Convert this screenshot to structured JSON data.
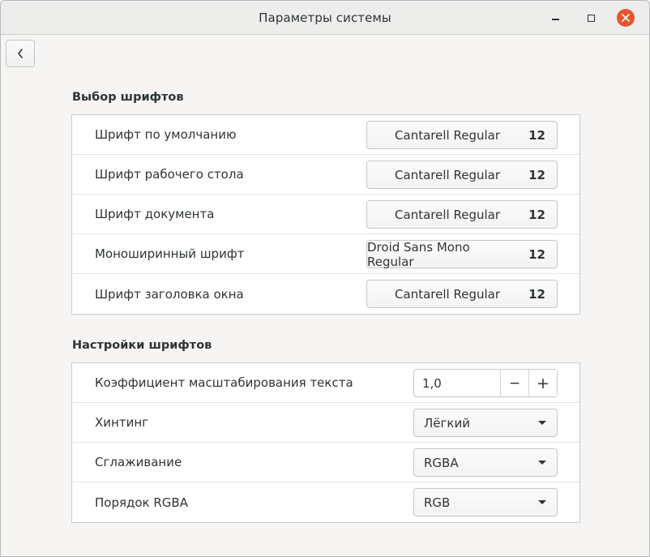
{
  "window": {
    "title": "Параметры системы"
  },
  "fonts_section": {
    "title": "Выбор шрифтов",
    "rows": [
      {
        "label": "Шрифт по умолчанию",
        "font": "Cantarell Regular",
        "size": "12"
      },
      {
        "label": "Шрифт рабочего стола",
        "font": "Cantarell Regular",
        "size": "12"
      },
      {
        "label": "Шрифт документа",
        "font": "Cantarell Regular",
        "size": "12"
      },
      {
        "label": "Моноширинный шрифт",
        "font": "Droid Sans Mono Regular",
        "size": "12"
      },
      {
        "label": "Шрифт заголовка окна",
        "font": "Cantarell Regular",
        "size": "12"
      }
    ]
  },
  "settings_section": {
    "title": "Настройки шрифтов",
    "scale": {
      "label": "Коэффициент масштабирования текста",
      "value": "1,0",
      "minus": "−",
      "plus": "+"
    },
    "hinting": {
      "label": "Хинтинг",
      "value": "Лёгкий"
    },
    "antialiasing": {
      "label": "Сглаживание",
      "value": "RGBA"
    },
    "rgba_order": {
      "label": "Порядок RGBA",
      "value": "RGB"
    }
  },
  "icons": {
    "back": "chevron-left-icon",
    "minimize": "minimize-icon",
    "maximize": "maximize-icon",
    "close": "close-icon",
    "dropdown": "triangle-down-icon"
  },
  "colors": {
    "close_button": "#e9542f",
    "background": "#f6f5f4",
    "panel": "#ffffff"
  }
}
